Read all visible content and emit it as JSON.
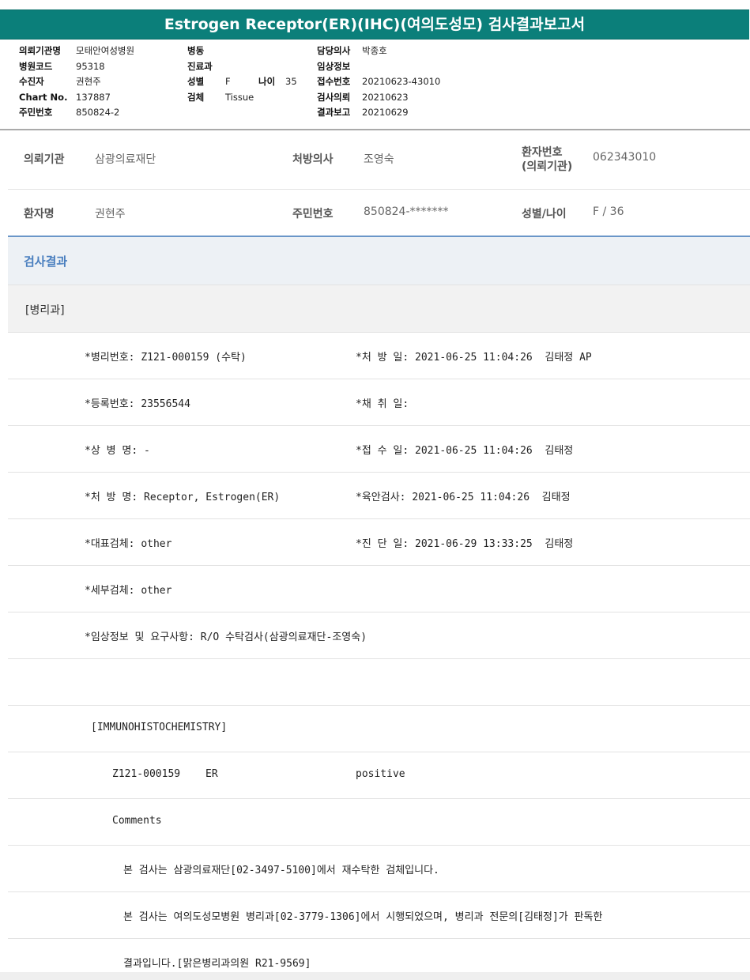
{
  "title": "Estrogen Receptor(ER)(IHC)(여의도성모) 검사결과보고서",
  "header": {
    "col1": [
      {
        "label": "의뢰기관명",
        "value": "모태안여성병원"
      },
      {
        "label": "병원코드",
        "value": "95318"
      },
      {
        "label": "수진자",
        "value": "권현주"
      },
      {
        "label": "Chart No.",
        "value": "137887"
      },
      {
        "label": "주민번호",
        "value": "850824-2"
      }
    ],
    "col2": {
      "ward_label": "병동",
      "dept_label": "진료과",
      "sex_label": "성별",
      "sex_value": "F",
      "age_label": "나이",
      "age_value": "35",
      "specimen_label": "검체",
      "specimen_value": "Tissue"
    },
    "col3": [
      {
        "label": "담당의사",
        "value": "박종호"
      },
      {
        "label": "임상정보",
        "value": ""
      },
      {
        "label": "접수번호",
        "value": "20210623-43010"
      },
      {
        "label": "검사의뢰",
        "value": "20210623"
      },
      {
        "label": "결과보고",
        "value": "20210629"
      }
    ]
  },
  "patient": {
    "institution_label": "의뢰기관",
    "institution": "삼광의료재단",
    "doctor_label": "처방의사",
    "doctor": "조영숙",
    "patient_no_label_1": "환자번호",
    "patient_no_label_2": "(의뢰기관)",
    "patient_no": "062343010",
    "name_label": "환자명",
    "name": "권현주",
    "rrn_label": "주민번호",
    "rrn": "850824-*******",
    "sex_age_label": "성별/나이",
    "sex_age": "F / 36"
  },
  "results": {
    "heading": "검사결과",
    "department": "[병리과]",
    "rows": [
      {
        "left": "*병리번호: Z121-000159 (수탁)",
        "right": "*처 방 일: 2021-06-25 11:04:26  김태정 AP"
      },
      {
        "left": "*등록번호: 23556544",
        "right": "*채 취 일:"
      },
      {
        "left": "*상 병 명: -",
        "right": "*접 수 일: 2021-06-25 11:04:26  김태정"
      },
      {
        "left": "*처 방 명: Receptor, Estrogen(ER)",
        "right": "*육안검사: 2021-06-25 11:04:26  김태정"
      },
      {
        "left": "*대표검체: other",
        "right": "*진 단 일: 2021-06-29 13:33:25  김태정"
      },
      {
        "left": "*세부검체: other",
        "right": ""
      },
      {
        "left": "*임상정보 및 요구사항: R/O 수탁검사(삼광의료재단-조영숙)",
        "right": ""
      }
    ],
    "ihc_heading": "[IMMUNOHISTOCHEMISTRY]",
    "ihc_id": "Z121-000159",
    "ihc_marker": "ER",
    "ihc_result": "positive",
    "comments_label": "Comments",
    "comment1": "본 검사는 삼광의료재단[02-3497-5100]에서 재수탁한 검체입니다.",
    "comment2": "본 검사는 여의도성모병원 병리과[02-3779-1306]에서 시행되었으며, 병리과 전문의[김태정]가 판독한",
    "comment3": "결과입니다.[맑은병리과의원 R21-9569]"
  }
}
